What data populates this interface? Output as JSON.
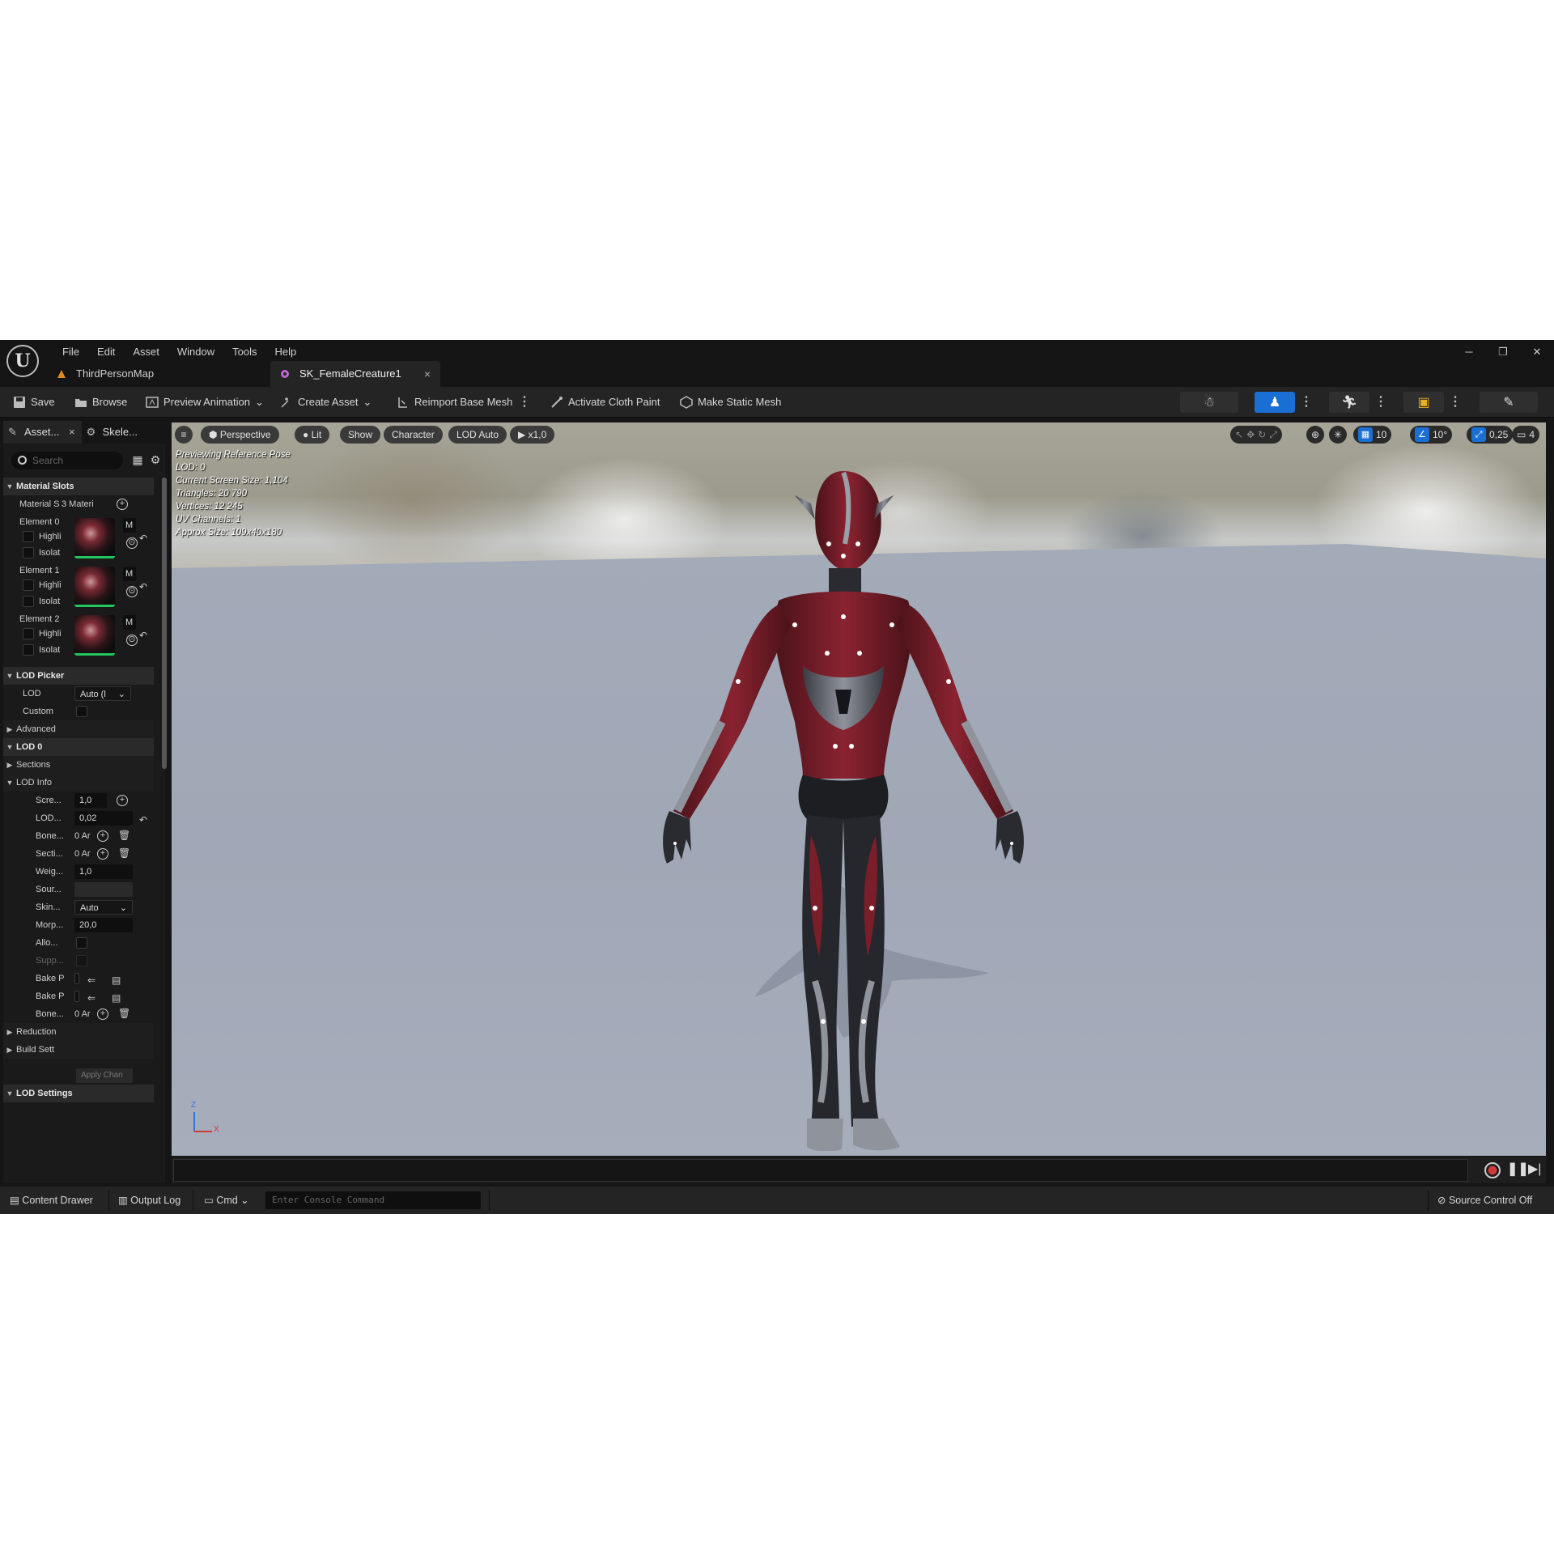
{
  "menu": [
    "File",
    "Edit",
    "Asset",
    "Window",
    "Tools",
    "Help"
  ],
  "tabs": [
    {
      "label": "ThirdPersonMap"
    },
    {
      "label": "SK_FemaleCreature1",
      "close": "×"
    }
  ],
  "window_controls": {
    "minimize": "─",
    "restore": "❐",
    "close": "✕"
  },
  "toolbar": {
    "save": "Save",
    "browse": "Browse",
    "preview_animation": "Preview Animation",
    "create_asset": "Create Asset",
    "reimport": "Reimport Base Mesh",
    "cloth_paint": "Activate Cloth Paint",
    "make_static": "Make Static Mesh"
  },
  "left_panel": {
    "tab_asset": "Asset...",
    "tab_asset_close": "×",
    "tab_skeleton": "Skele...",
    "search_placeholder": "Search",
    "material_slots": "Material Slots",
    "material_slots_label": "Material S",
    "material_slots_value": "3 Materi",
    "elements": [
      {
        "label": "Element 0",
        "highlight": "Highli",
        "isolate": "Isolat",
        "m": "M"
      },
      {
        "label": "Element 1",
        "highlight": "Highli",
        "isolate": "Isolat",
        "m": "M"
      },
      {
        "label": "Element 2",
        "highlight": "Highli",
        "isolate": "Isolat",
        "m": "M"
      }
    ],
    "lod_picker": "LOD Picker",
    "lod_label": "LOD",
    "lod_value": "Auto (l",
    "custom_label": "Custom",
    "advanced": "Advanced",
    "lod0": "LOD 0",
    "sections": "Sections",
    "lod_info": "LOD Info",
    "screen_label": "Scre...",
    "screen_value": "1,0",
    "lodh_label": "LOD...",
    "lodh_value": "0,02",
    "bone_label": "Bone...",
    "bone_value": "0 Ar",
    "sect_label": "Secti...",
    "sect_value": "0 Ar",
    "weig_label": "Weig...",
    "weig_value": "1,0",
    "sour_label": "Sour...",
    "skin_label": "Skin...",
    "skin_value": "Auto",
    "morp_label": "Morp...",
    "morp_value": "20,0",
    "allo_label": "Allo...",
    "supp_label": "Supp...",
    "bake1_label": "Bake P",
    "bake2_label": "Bake P",
    "bone2_label": "Bone...",
    "bone2_value": "0 Ar",
    "reduction": "Reduction",
    "build_settings": "Build Sett",
    "apply_changes": "Apply Chan",
    "lod_settings": "LOD Settings"
  },
  "viewport": {
    "perspective": "Perspective",
    "lit": "Lit",
    "show": "Show",
    "character": "Character",
    "lod_auto": "LOD Auto",
    "play_speed": "x1,0",
    "grid": "10",
    "angle": "10°",
    "scale": "0,25",
    "camera": "4",
    "stats": [
      "Previewing Reference Pose",
      "LOD: 0",
      "Current Screen Size: 1,104",
      "Triangles: 20 790",
      "Vertices: 12 245",
      "UV Channels: 1",
      "Approx Size: 109x40x180"
    ],
    "axis_z": "Z",
    "axis_x": "X"
  },
  "statusbar": {
    "content_drawer": "Content Drawer",
    "output_log": "Output Log",
    "cmd": "Cmd",
    "console_placeholder": "Enter Console Command",
    "source_control": "Source Control Off"
  },
  "colors": {
    "accent": "#1a6fd4",
    "panel": "#1a1a1a",
    "toolbar": "#242424",
    "suit_red": "#7a1e2a",
    "suit_gray": "#8a8e96"
  }
}
